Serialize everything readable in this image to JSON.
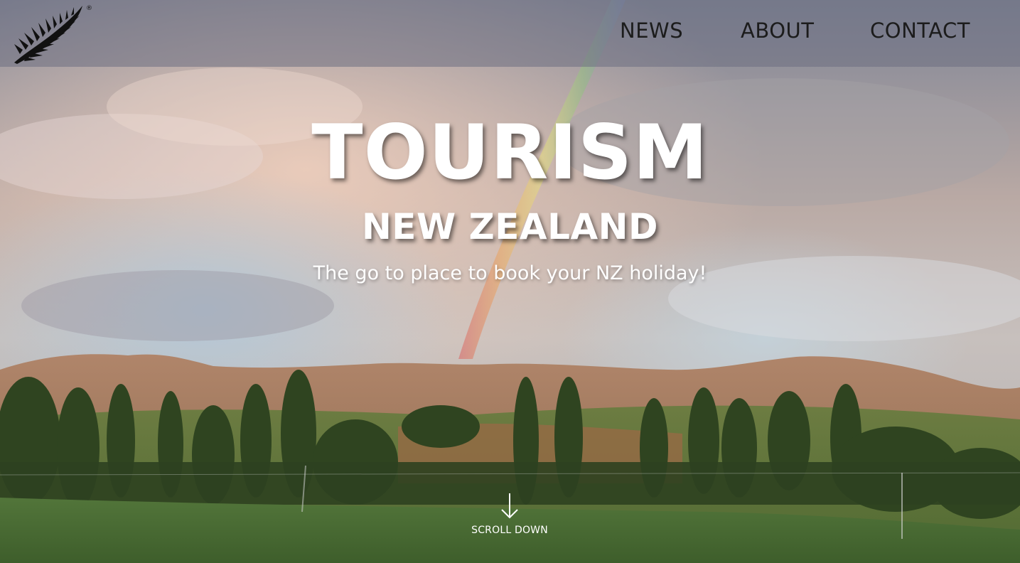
{
  "nav": {
    "logo_icon": "silver-fern-icon",
    "logo_mark": "®",
    "links": [
      {
        "label": "NEWS"
      },
      {
        "label": "ABOUT"
      },
      {
        "label": "CONTACT"
      }
    ]
  },
  "hero": {
    "title": "TOURISM",
    "subtitle": "NEW ZEALAND",
    "tagline": "The go to place to book your NZ holiday!",
    "scroll_label": "SCROLL DOWN",
    "scroll_icon": "arrow-down-icon"
  },
  "colors": {
    "navbar_bg": "#6e7082",
    "nav_text": "#1c1c1c",
    "hero_text": "#ffffff",
    "sky": "#9aa0ac",
    "hills": "#a57a5a",
    "grass": "#4f6b35",
    "trees": "#2f4420"
  }
}
